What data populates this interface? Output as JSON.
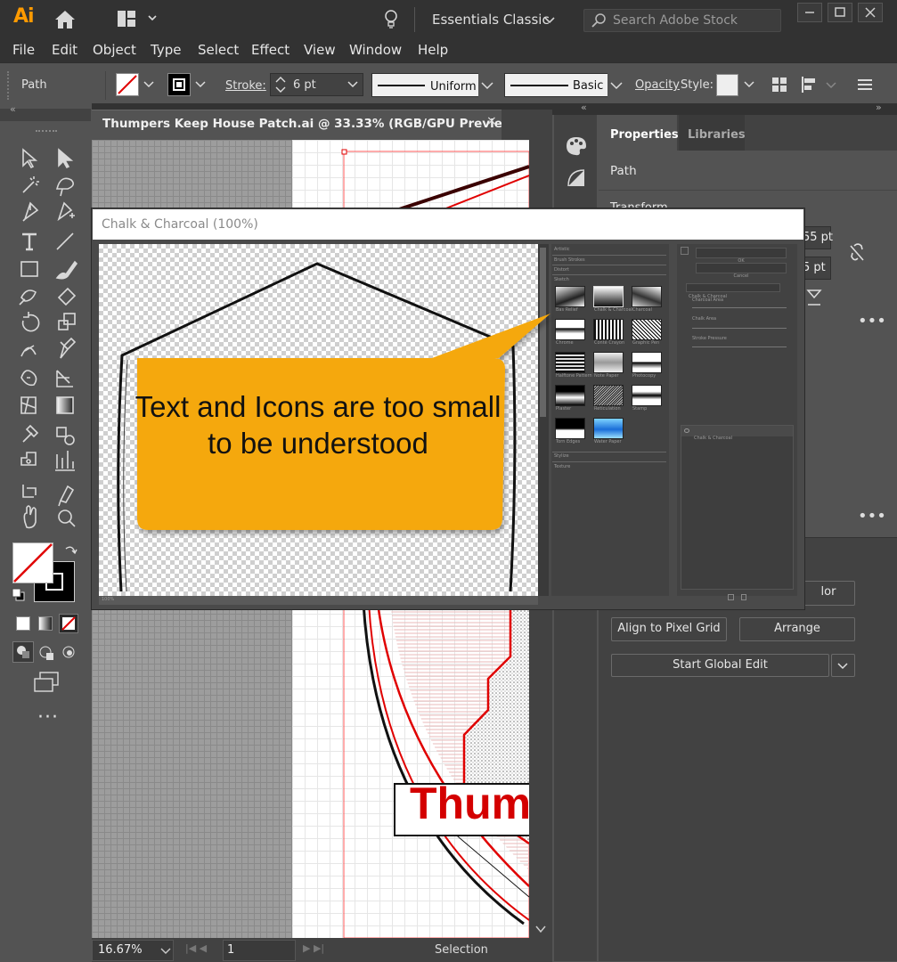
{
  "app": {
    "logo": "Ai",
    "workspace": "Essentials Classic",
    "search_placeholder": "Search Adobe Stock"
  },
  "menu": [
    "File",
    "Edit",
    "Object",
    "Type",
    "Select",
    "Effect",
    "View",
    "Window",
    "Help"
  ],
  "control": {
    "selection_type": "Path",
    "stroke_label": "Stroke:",
    "stroke_value": "6 pt",
    "profile": "Uniform",
    "brush": "Basic",
    "opacity_label": "Opacity",
    "style_label": "Style:"
  },
  "document": {
    "tab_title": "Thumpers Keep House Patch.ai @ 33.33% (RGB/GPU Previe...",
    "close": "×",
    "artwork_text": "Thum"
  },
  "status": {
    "zoom": "16.67%",
    "artboard": "1",
    "tool": "Selection"
  },
  "panel": {
    "tabs": [
      "Properties",
      "Libraries"
    ],
    "section": "Path",
    "transform_label": "Transform",
    "field_w_suffix": "55 pt",
    "field_h_suffix": "5 pt",
    "recolor_label": "lor",
    "align_pixel_grid": "Align to Pixel Grid",
    "arrange": "Arrange",
    "start_global_edit": "Start Global Edit"
  },
  "dialog": {
    "title": "Chalk & Charcoal (100%)",
    "gallery_folders": [
      "Artistic",
      "Brush Strokes",
      "Distort",
      "Sketch"
    ],
    "gallery_folders_bottom": [
      "Stylize",
      "Texture"
    ],
    "thumbs": [
      "Bas Relief",
      "Chalk & Charcoal",
      "Charcoal",
      "Chrome",
      "Conté Crayon",
      "Graphic Pen",
      "Halftone Pattern",
      "Note Paper",
      "Photocopy",
      "Plaster",
      "Reticulation",
      "Stamp",
      "Torn Edges",
      "Water Paper"
    ],
    "ok": "OK",
    "cancel": "Cancel",
    "filter_select": "Chalk & Charcoal",
    "sliders": [
      "Charcoal Area",
      "Chalk Area",
      "Stroke Pressure"
    ],
    "layer_label": "Chalk & Charcoal",
    "zoom": "100%"
  },
  "callout": {
    "text": "Text and Icons are too small to be understood"
  },
  "colors": {
    "accent_orange": "#f5a80a",
    "illustrator_orange": "#ff9a00",
    "artwork_red": "#e00000"
  }
}
